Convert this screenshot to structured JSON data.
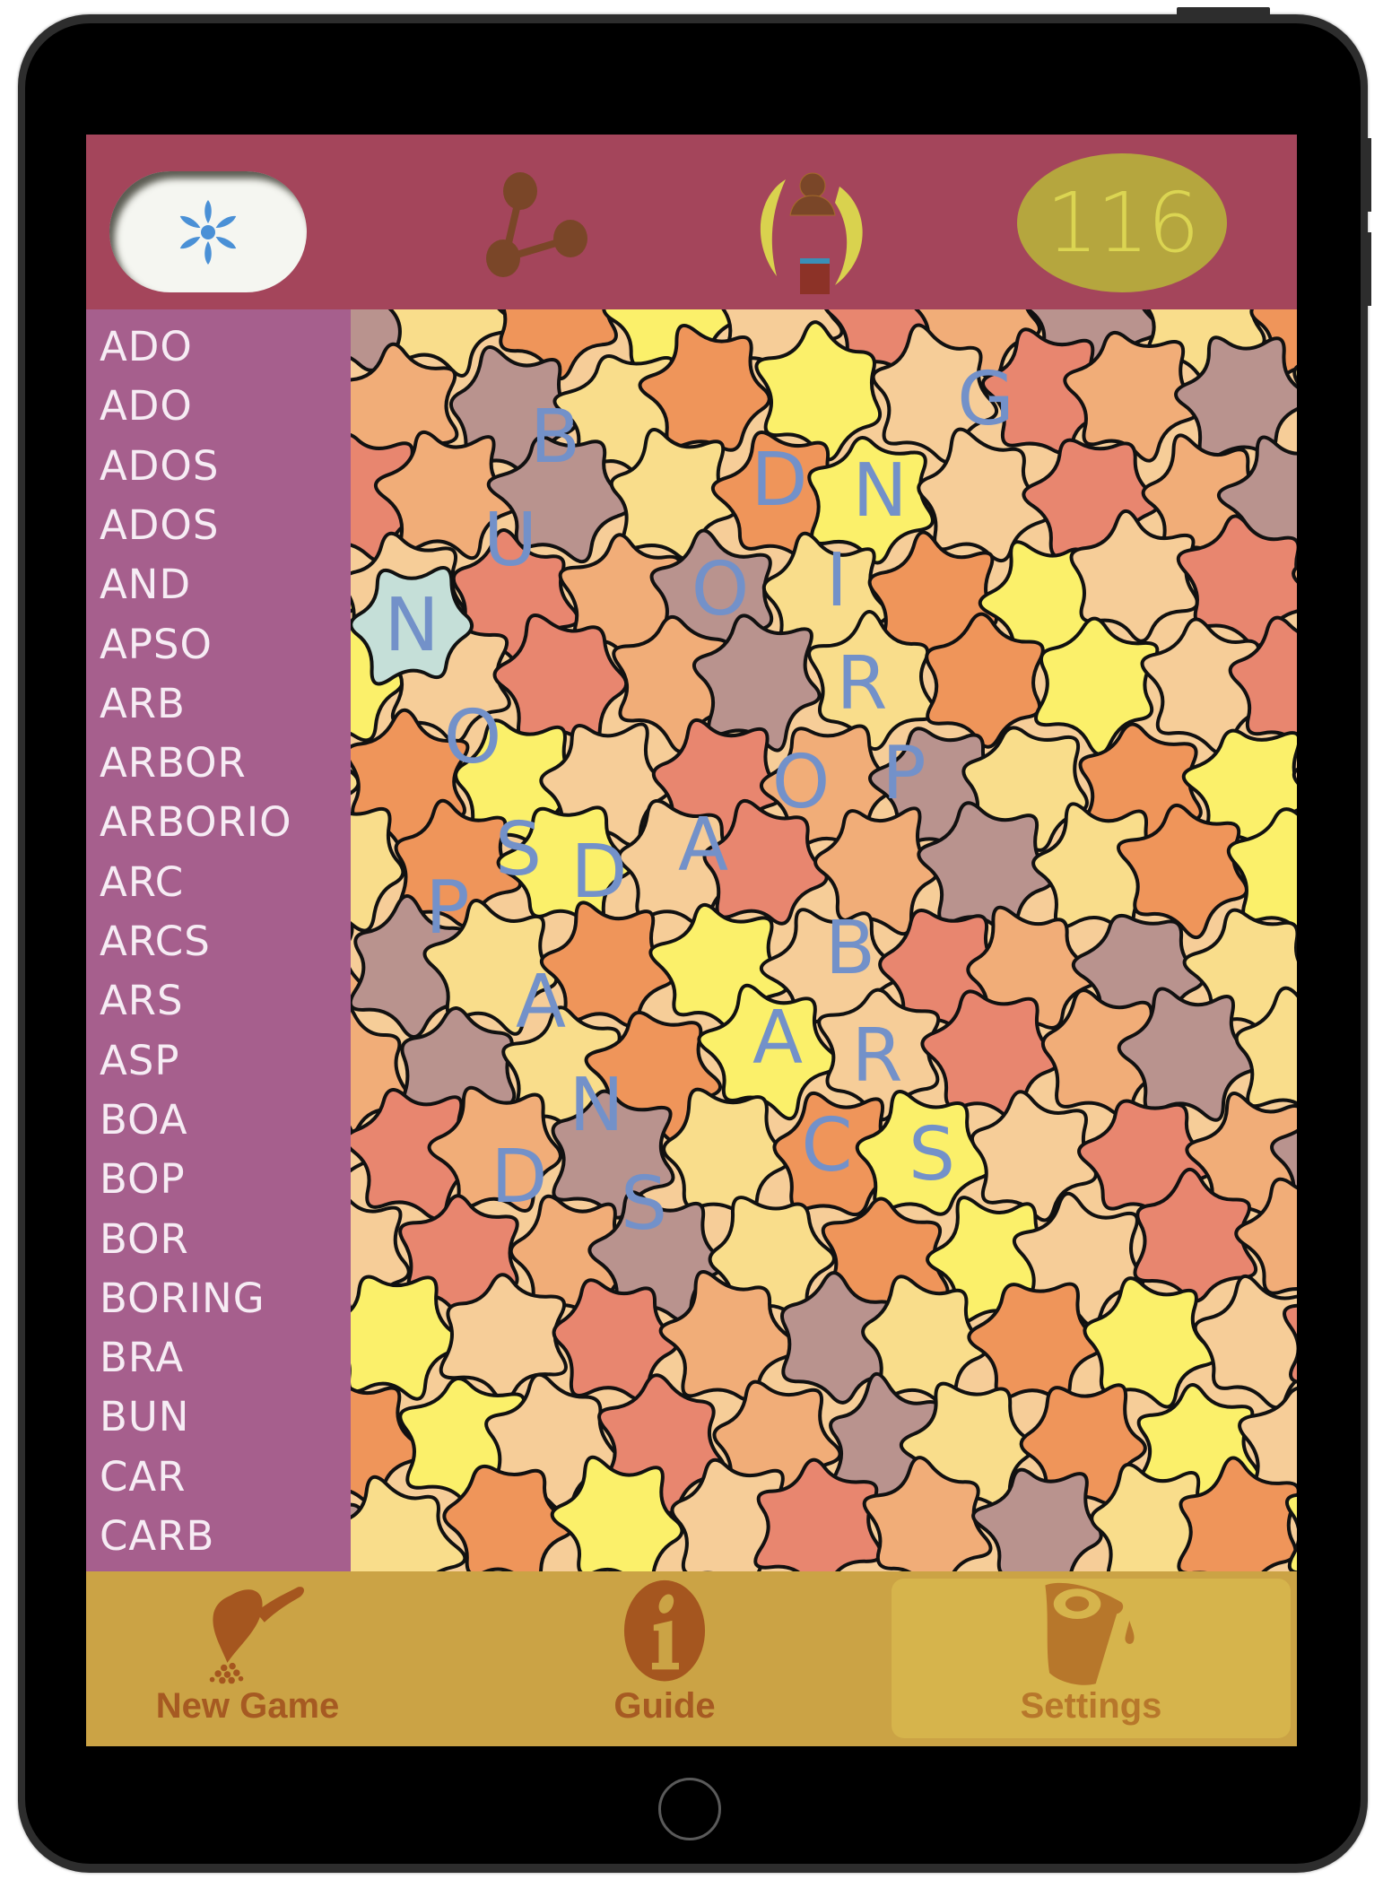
{
  "topbar": {
    "hint_button": {
      "icon": "asterisk-icon",
      "color": "#4a90d6"
    },
    "share_button": {
      "icon": "share-icon",
      "color": "#7a4628"
    },
    "profile_button": {
      "icon": "player-profile-icon"
    },
    "score": "116"
  },
  "word_list": [
    "ADO",
    "ADO",
    "ADOS",
    "ADOS",
    "AND",
    "APSO",
    "ARB",
    "ARBOR",
    "ARBORIO",
    "ARC",
    "ARCS",
    "ARS",
    "ASP",
    "BOA",
    "BOP",
    "BOR",
    "BORING",
    "BRA",
    "BUN",
    "CAR",
    "CARB"
  ],
  "board": {
    "tile_letters": [
      {
        "letter": "B"
      },
      {
        "letter": "G"
      },
      {
        "letter": "D"
      },
      {
        "letter": "N"
      },
      {
        "letter": "U"
      },
      {
        "letter": "N"
      },
      {
        "letter": "O"
      },
      {
        "letter": "I"
      },
      {
        "letter": "R"
      },
      {
        "letter": "O"
      },
      {
        "letter": "O"
      },
      {
        "letter": "P"
      },
      {
        "letter": "S"
      },
      {
        "letter": "A"
      },
      {
        "letter": "D"
      },
      {
        "letter": "P"
      },
      {
        "letter": "B"
      },
      {
        "letter": "A"
      },
      {
        "letter": "A"
      },
      {
        "letter": "R"
      },
      {
        "letter": "N"
      },
      {
        "letter": "C"
      },
      {
        "letter": "S"
      },
      {
        "letter": "D"
      },
      {
        "letter": "S"
      }
    ],
    "tile_colors": [
      "#ef955a",
      "#e8866f",
      "#f9dd8b",
      "#f6cd98",
      "#b9938e",
      "#fbf06a",
      "#f1ad78"
    ],
    "selected_tile_color": "#c5dfd8",
    "letter_color": "#7391c9"
  },
  "bottombar": {
    "tabs": [
      {
        "label": "New Game",
        "icon": "scoop-pouring-icon",
        "active": false
      },
      {
        "label": "Guide",
        "icon": "info-icon",
        "active": false
      },
      {
        "label": "Settings",
        "icon": "cup-icon",
        "active": true
      }
    ]
  }
}
